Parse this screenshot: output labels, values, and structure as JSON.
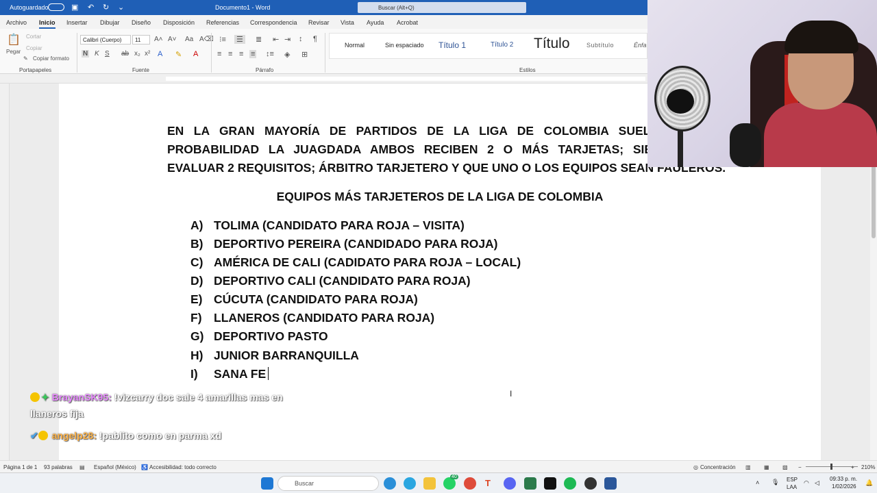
{
  "titlebar": {
    "autosave_label": "Autoguardado",
    "doc_title": "Documento1 - Word",
    "search_placeholder": "Buscar (Alt+Q)"
  },
  "ribbon_tabs": [
    "Archivo",
    "Inicio",
    "Insertar",
    "Dibujar",
    "Diseño",
    "Disposición",
    "Referencias",
    "Correspondencia",
    "Revisar",
    "Vista",
    "Ayuda",
    "Acrobat"
  ],
  "ribbon": {
    "paste_label": "Pegar",
    "cut_label": "Cortar",
    "copy_label": "Copiar",
    "format_painter_label": "Copiar formato",
    "clipboard_group": "Portapapeles",
    "font_name": "Calibri (Cuerpo)",
    "font_size": "11",
    "font_group": "Fuente",
    "paragraph_group": "Párrafo",
    "styles_group": "Estilos",
    "styles": [
      "Normal",
      "Sin espaciado",
      "Título 1",
      "Título 2",
      "Título",
      "Subtítulo",
      "Énfa"
    ]
  },
  "document": {
    "paragraph_lines": [
      "EN LA GRAN MAYORÍA DE PARTIDOS DE LA LIGA DE COLOMBIA SUELE SALIR",
      "PROBABILIDAD LA JUAGDADA AMBOS RECIBEN 2 O MÁS TARJETAS; SIEMPRE E",
      "EVALUAR 2 REQUISITOS; ÁRBITRO TARJETERO Y QUE UNO O LOS EQUIPOS SEAN FAULEROS."
    ],
    "heading": "EQUIPOS MÁS TARJETEROS DE LA LIGA DE COLOMBIA",
    "list": [
      {
        "label": "A)",
        "text": "TOLIMA (CANDIDATO PARA ROJA – VISITA)"
      },
      {
        "label": "B)",
        "text": "DEPORTIVO PEREIRA (CANDIDADO PARA ROJA)"
      },
      {
        "label": "C)",
        "text": "AMÉRICA DE CALI (CADIDATO PARA ROJA – LOCAL)"
      },
      {
        "label": "D)",
        "text": "DEPORTIVO CALI (CANDIDATO PARA ROJA)"
      },
      {
        "label": "E)",
        "text": "CÚCUTA (CANDIDATO PARA ROJA)"
      },
      {
        "label": "F)",
        "text": "LLANEROS (CANDIDATO PARA ROJA)"
      },
      {
        "label": "G)",
        "text": "DEPORTIVO PASTO"
      },
      {
        "label": "H)",
        "text": "JUNIOR BARRANQUILLA"
      },
      {
        "label": "I)",
        "text": "SANA FE"
      }
    ]
  },
  "chat": [
    {
      "user": "BrayanSK95:",
      "message": "!vizcarry doc sale 4 amarillas mas en",
      "message_cont": "llaneros fija"
    },
    {
      "user": "angelp28:",
      "message": "!pablito como en parma xd"
    }
  ],
  "statusbar": {
    "page": "Página 1 de 1",
    "words": "93 palabras",
    "language": "Español (México)",
    "accessibility": "Accesibilidad: todo correcto",
    "focus": "Concentración",
    "zoom": "210%"
  },
  "taskbar": {
    "search_placeholder": "Buscar",
    "badge_count": "40",
    "lang_top": "ESP",
    "lang_bottom": "LAA",
    "time": "09:33 p. m.",
    "date": "1/02/2026"
  },
  "colors": {
    "titlebar": "#1f5fb6",
    "chat_user1": "#e889ff",
    "chat_user2": "#ffb347"
  }
}
